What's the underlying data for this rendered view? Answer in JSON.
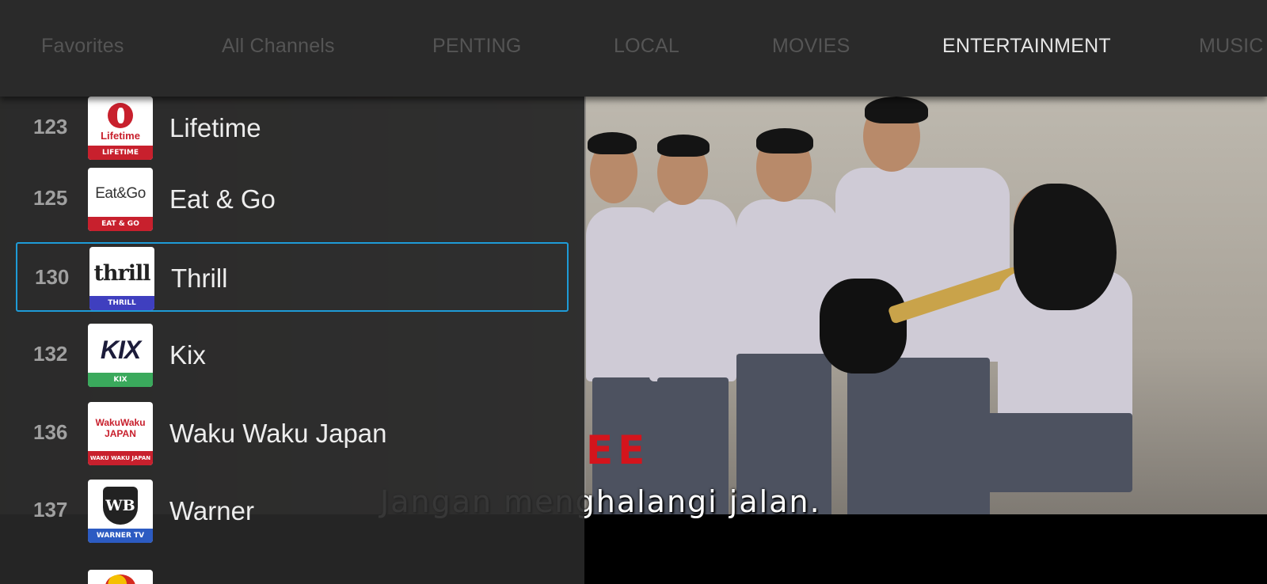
{
  "tabs": [
    {
      "label": "Favorites",
      "active": false
    },
    {
      "label": "All Channels",
      "active": false
    },
    {
      "label": "PENTING",
      "active": false
    },
    {
      "label": "LOCAL",
      "active": false
    },
    {
      "label": "MOVIES",
      "active": false
    },
    {
      "label": "ENTERTAINMENT",
      "active": true
    },
    {
      "label": "MUSIC",
      "active": false
    }
  ],
  "channels": [
    {
      "number": "123",
      "name": "Lifetime",
      "logo_text": "Lifetime",
      "band_text": "LIFETIME",
      "band_color": "#c8202d",
      "focused": false
    },
    {
      "number": "125",
      "name": "Eat & Go",
      "logo_text": "Eat&Go",
      "band_text": "EAT & GO",
      "band_color": "#c8202d",
      "focused": false
    },
    {
      "number": "130",
      "name": "Thrill",
      "logo_text": "thrill",
      "band_text": "THRILL",
      "band_color": "#3f3fbf",
      "focused": true
    },
    {
      "number": "132",
      "name": "Kix",
      "logo_text": "KIX",
      "band_text": "KIX",
      "band_color": "#3aa95c",
      "focused": false
    },
    {
      "number": "136",
      "name": "Waku Waku Japan",
      "logo_text": "WakuWaku JAPAN",
      "band_text": "WAKU WAKU JAPAN",
      "band_color": "#c8202d",
      "focused": false
    },
    {
      "number": "137",
      "name": "Warner",
      "logo_text": "WB",
      "band_text": "WARNER TV",
      "band_color": "#2c5bc2",
      "focused": false
    }
  ],
  "video": {
    "subtitle": "Jangan menghalangi jalan.",
    "watermark": "EE"
  },
  "colors": {
    "focus_border": "#1e9bd7",
    "active_tab": "#e6e6e6",
    "inactive_tab": "#555555"
  }
}
